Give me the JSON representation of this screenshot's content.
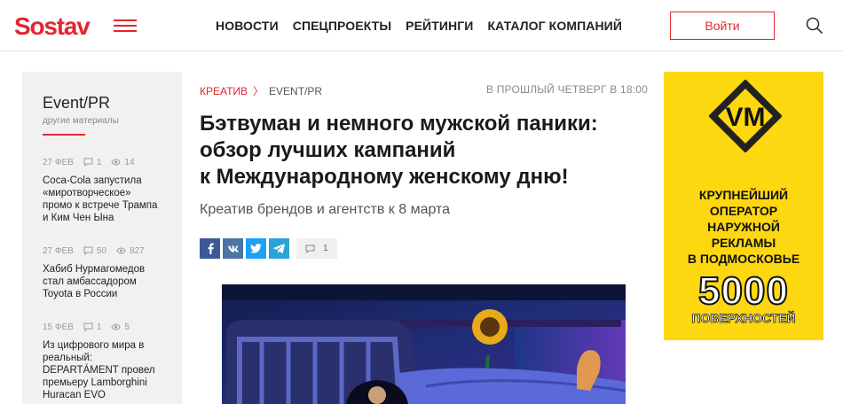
{
  "header": {
    "logo": "Sostav",
    "nav": [
      "НОВОСТИ",
      "СПЕЦПРОЕКТЫ",
      "РЕЙТИНГИ",
      "КАТАЛОГ КОМПАНИЙ"
    ],
    "login_label": "Войти"
  },
  "sidebar": {
    "title": "Event/PR",
    "subtitle": "другие материалы",
    "items": [
      {
        "date": "27 ФЕВ",
        "comments": "1",
        "views": "14",
        "text": "Coca-Cola запустила «миротворческое» промо к встрече Трампа и Ким Чен Ына"
      },
      {
        "date": "27 ФЕВ",
        "comments": "50",
        "views": "827",
        "text": "Хабиб Нурмагомедов стал амбассадором Toyota в России"
      },
      {
        "date": "15 ФЕВ",
        "comments": "1",
        "views": "5",
        "text": "Из цифрового мира в реальный: DEPARTÁMENT провел премьеру Lamborghini Huracan EVO"
      }
    ]
  },
  "article": {
    "breadcrumb_category": "КРЕАТИВ",
    "breadcrumb_sep": "〉",
    "breadcrumb_section": "EVENT/PR",
    "date": "В ПРОШЛЫЙ ЧЕТВЕРГ В 18:00",
    "title_lines": [
      "Бэтвуман и немного мужской паники:",
      "обзор лучших кампаний",
      "к Международному женскому дню!"
    ],
    "subtitle": "Креатив брендов и агентств к 8 марта",
    "comments_count": "1"
  },
  "ad": {
    "logo_text": "VM",
    "lines": [
      "КРУПНЕЙШИЙ",
      "ОПЕРАТОР",
      "НАРУЖНОЙ",
      "РЕКЛАМЫ",
      "В ПОДМОСКОВЬЕ"
    ],
    "big_number": "5000",
    "big_caption": "ПОВЕРХНОСТЕЙ"
  },
  "colors": {
    "brand_red": "#e3262e",
    "ad_yellow": "#fdd70f",
    "facebook": "#3b5998",
    "vk": "#4c75a3",
    "twitter": "#1da1f2",
    "telegram": "#2aa3d9"
  },
  "icons": [
    "hamburger-menu-icon",
    "search-icon",
    "comment-icon",
    "views-icon",
    "facebook-icon",
    "vk-icon",
    "twitter-icon",
    "telegram-icon"
  ]
}
